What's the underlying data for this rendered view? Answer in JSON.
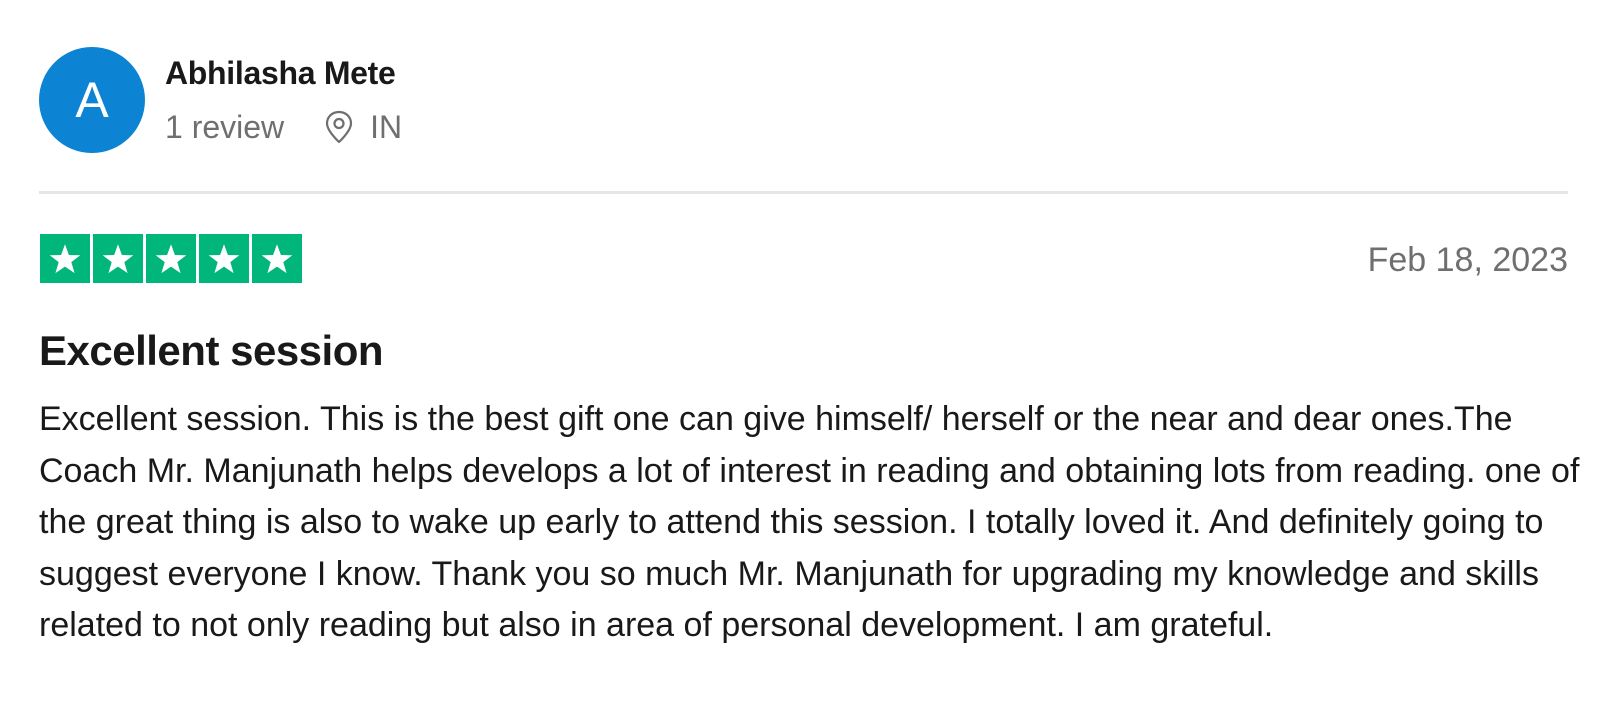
{
  "reviewer": {
    "avatar_letter": "A",
    "avatar_color": "#0d83d4",
    "name": "Abhilasha Mete",
    "review_count": "1 review",
    "location_icon": "location-pin-icon",
    "country": "IN"
  },
  "review": {
    "rating": 5,
    "rating_max": 5,
    "star_color": "#00b67a",
    "star_icon": "star-icon",
    "date": "Feb 18, 2023",
    "title": "Excellent session",
    "body": "Excellent session. This is the best gift one can give himself/ herself or the near and dear ones.The Coach Mr. Manjunath helps develops a lot of interest in reading and obtaining lots from reading. one of the great thing is also to wake up early to attend this session. I totally loved it. And definitely going to suggest everyone I know. Thank you so much Mr. Manjunath for upgrading my knowledge and skills related to not only reading but also in area of personal development. I am grateful."
  }
}
